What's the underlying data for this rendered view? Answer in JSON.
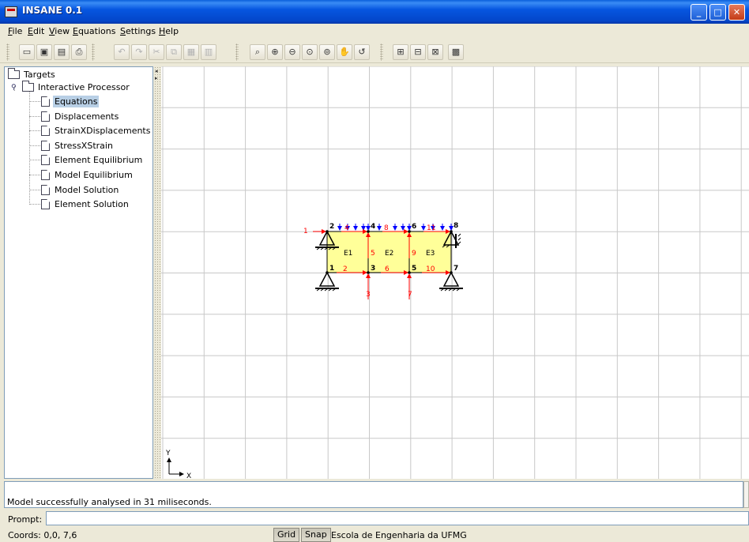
{
  "window": {
    "title": "INSANE 0.1"
  },
  "menu": [
    {
      "label": "File",
      "mn": "F",
      "rest": "ile"
    },
    {
      "label": "Edit",
      "mn": "E",
      "rest": "dit"
    },
    {
      "label": "View",
      "mn": "V",
      "rest": "iew"
    },
    {
      "label": "Equations",
      "mn": "E",
      "rest": "quations"
    },
    {
      "label": "Settings",
      "mn": "S",
      "rest": "ettings"
    },
    {
      "label": "Help",
      "mn": "H",
      "rest": "elp"
    }
  ],
  "toolbar": {
    "buttons": [
      {
        "name": "open-icon",
        "glyph": "▭"
      },
      {
        "name": "save-icon",
        "glyph": "▣"
      },
      {
        "name": "save-as-icon",
        "glyph": "▤"
      },
      {
        "name": "print-icon",
        "glyph": "⎙"
      },
      {
        "name": "undo-icon",
        "glyph": "↶"
      },
      {
        "name": "redo-icon",
        "glyph": "↷"
      },
      {
        "name": "cut-icon",
        "glyph": "✂"
      },
      {
        "name": "copy-icon",
        "glyph": "⧉"
      },
      {
        "name": "paste-icon",
        "glyph": "▦"
      },
      {
        "name": "delete-icon",
        "glyph": "▥"
      },
      {
        "name": "zoom-icon",
        "glyph": "⌕"
      },
      {
        "name": "zoom-in-icon",
        "glyph": "⊕"
      },
      {
        "name": "zoom-out-icon",
        "glyph": "⊖"
      },
      {
        "name": "zoom-fit-icon",
        "glyph": "⊙"
      },
      {
        "name": "zoom-previous-icon",
        "glyph": "⊚"
      },
      {
        "name": "pan-icon",
        "glyph": "✋"
      },
      {
        "name": "redraw-icon",
        "glyph": "↺"
      },
      {
        "name": "grid-icon",
        "glyph": "⊞"
      },
      {
        "name": "snap-icon",
        "glyph": "⊟"
      },
      {
        "name": "node-icon",
        "glyph": "⊠"
      },
      {
        "name": "analyse-icon",
        "glyph": "▩"
      }
    ]
  },
  "tree": {
    "root": "Targets",
    "processor": "Interactive Processor",
    "items": [
      "Equations",
      "Displacements",
      "StrainXDisplacements",
      "StressXStrain",
      "Element Equilibrium",
      "Model Equilibrium",
      "Model Solution",
      "Element Solution"
    ],
    "selected": "Equations"
  },
  "model": {
    "nodes": [
      "1",
      "2",
      "3",
      "4",
      "5",
      "6",
      "7",
      "8"
    ],
    "elements": [
      "E1",
      "E2",
      "E3"
    ],
    "dofs": [
      "1",
      "2",
      "3",
      "4",
      "5",
      "6",
      "7",
      "8",
      "9",
      "10",
      "11"
    ],
    "colors": {
      "element_fill": "#ffff99",
      "load_arrow": "#0000ff",
      "dof_arrow": "#ff0000",
      "grid": "#c8c8c8"
    }
  },
  "axes": {
    "x": "X",
    "y": "Y"
  },
  "console": {
    "message": "Model successfully analysed in 31 miliseconds."
  },
  "prompt": {
    "label": "Prompt:",
    "value": ""
  },
  "status": {
    "coords": "Coords: 0,0, 7,6",
    "grid": "Grid",
    "snap": "Snap",
    "school": "Escola de Engenharia da UFMG"
  }
}
